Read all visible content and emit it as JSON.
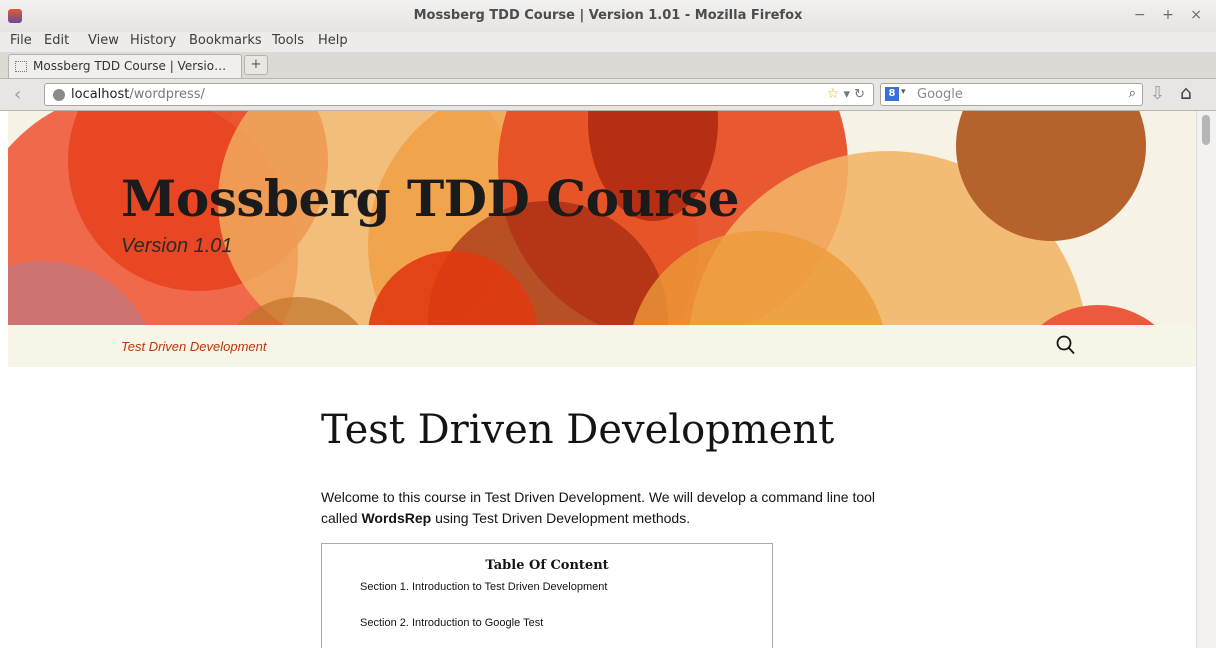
{
  "window": {
    "title": "Mossberg TDD Course | Version 1.01 - Mozilla Firefox",
    "controls": "− + ×"
  },
  "menu": [
    "File",
    "Edit",
    "View",
    "History",
    "Bookmarks",
    "Tools",
    "Help"
  ],
  "tab": {
    "label": "Mossberg TDD Course | Versio…",
    "new_tab": "+"
  },
  "nav": {
    "back": "‹",
    "url_host": "localhost",
    "url_path": "/wordpress/",
    "url_actions": "▾ ↻",
    "star": "☆",
    "search_placeholder": "Google",
    "search_engine": "8",
    "search_caret": "▾",
    "search_go": "⌕",
    "downloads": "⇩",
    "home": "⌂"
  },
  "site": {
    "title": "Mossberg TDD Course",
    "description": "Version 1.01",
    "nav_link": "Test Driven Development"
  },
  "page": {
    "title": "Test Driven Development",
    "intro_before": "Welcome to this course in Test Driven Development. We will develop a command line tool called ",
    "intro_bold": "WordsRep",
    "intro_after": " using Test Driven Development methods.",
    "toc_title": "Table Of Content",
    "toc": [
      "Section 1. Introduction to Test Driven Development",
      "Section 2. Introduction to Google Test"
    ]
  },
  "colors": {
    "accent": "#bc360a",
    "header_bg": "#f6f2e6",
    "nav_bg": "#f7f5e7"
  }
}
